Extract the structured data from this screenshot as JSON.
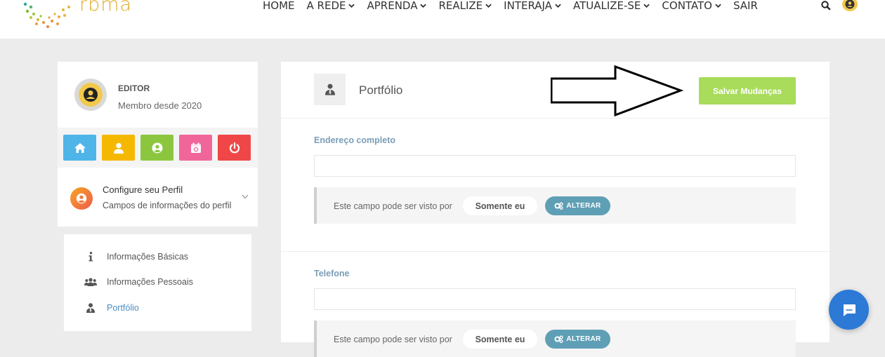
{
  "brand": {
    "name": "rbma"
  },
  "nav": {
    "items": [
      {
        "label": "HOME",
        "dropdown": false
      },
      {
        "label": "A REDE",
        "dropdown": true
      },
      {
        "label": "APRENDA",
        "dropdown": true
      },
      {
        "label": "REALIZE",
        "dropdown": true
      },
      {
        "label": "INTERAJA",
        "dropdown": true
      },
      {
        "label": "ATUALIZE-SE",
        "dropdown": true
      },
      {
        "label": "CONTATO",
        "dropdown": true
      },
      {
        "label": "SAIR",
        "dropdown": false
      }
    ],
    "search_icon": "search-icon",
    "avatar_icon": "user-avatar-icon"
  },
  "profile": {
    "name": "EDITOR",
    "member_since": "Membro desde 2020"
  },
  "quick_actions": [
    {
      "icon": "home-icon",
      "color": "#4fb5e8"
    },
    {
      "icon": "user-icon",
      "color": "#f5b800"
    },
    {
      "icon": "user-circle-icon",
      "color": "#8cc63f"
    },
    {
      "icon": "calendar-icon",
      "color": "#f0669a"
    },
    {
      "icon": "power-icon",
      "color": "#ef4747"
    }
  ],
  "config": {
    "title": "Configure seu Perfil",
    "subtitle": "Campos de informações do perfil"
  },
  "menu": {
    "items": [
      {
        "label": "Informações Básicas",
        "icon": "info-icon",
        "active": false
      },
      {
        "label": "Informações Pessoais",
        "icon": "users-icon",
        "active": false
      },
      {
        "label": "Portfólio",
        "icon": "user-tie-icon",
        "active": true
      }
    ]
  },
  "main": {
    "title": "Portfólio",
    "save_label": "Salvar Mudanças",
    "fields": [
      {
        "label": "Endereço completo",
        "value": "",
        "visibility_text": "Este campo pode ser visto por",
        "visibility_value": "Somente eu",
        "change_label": "ALTERAR"
      },
      {
        "label": "Telefone",
        "value": "",
        "visibility_text": "Este campo pode ser visto por",
        "visibility_value": "Somente eu",
        "change_label": "ALTERAR"
      }
    ]
  },
  "colors": {
    "accent_green": "#a8dc5a",
    "field_label": "#7a9eb8",
    "change_button": "#5f9fb5",
    "chat": "#2c79d6"
  }
}
